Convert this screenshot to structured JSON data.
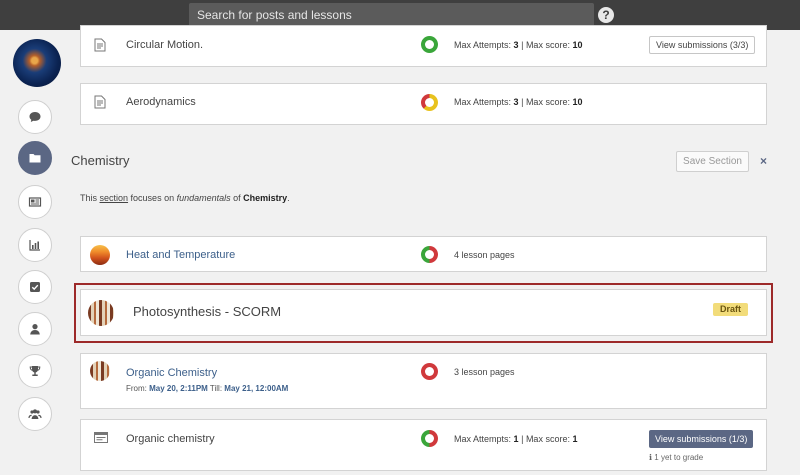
{
  "topbar": {
    "search_placeholder": "Search for posts and lessons",
    "help_icon": "?"
  },
  "sidebar": {
    "avatar": "user-avatar",
    "items": [
      "messages",
      "folder",
      "news",
      "reports",
      "tasks",
      "profile",
      "achievements",
      "groups"
    ],
    "active": "folder"
  },
  "rows_top": [
    {
      "name": "Circular Motion.",
      "attempts_label": "Max Attempts:",
      "attempts": "3",
      "sep": "|",
      "score_label": "Max score:",
      "score": "10",
      "button": "View submissions (3/3)"
    },
    {
      "name": "Aerodynamics",
      "attempts_label": "Max Attempts:",
      "attempts": "3",
      "sep": "|",
      "score_label": "Max score:",
      "score": "10"
    }
  ],
  "section": {
    "title": "Chemistry",
    "save_label": "Save Section",
    "close_label": "×",
    "desc": {
      "p1": "This ",
      "link": "section",
      "p2": " focuses on ",
      "em": "fundamentals",
      "p3": " of ",
      "strong": "Chemistry",
      "p4": "."
    }
  },
  "lessons": [
    {
      "name": "Heat and Temperature",
      "info": "4 lesson pages"
    },
    {
      "name": "Photosynthesis - SCORM",
      "badge": "Draft"
    },
    {
      "name": "Organic Chemistry",
      "info": "3 lesson pages",
      "from_label": "From:",
      "from": "May 20, 2:11PM",
      "till_label": "Till:",
      "till": "May 21, 12:00AM"
    },
    {
      "name": "Organic chemistry",
      "attempts_label": "Max Attempts:",
      "attempts": "1",
      "sep": "|",
      "score_label": "Max score:",
      "score": "1",
      "button": "View submissions (1/3)",
      "grade_note": "1 yet to grade",
      "info_icon": "ℹ"
    }
  ],
  "colors": {
    "accent": "#5b6784",
    "green": "#3aa63a",
    "red": "#d0393c",
    "yellow": "#e8c21e",
    "highlight": "#9d2a2a",
    "link": "#3c5f8a"
  }
}
